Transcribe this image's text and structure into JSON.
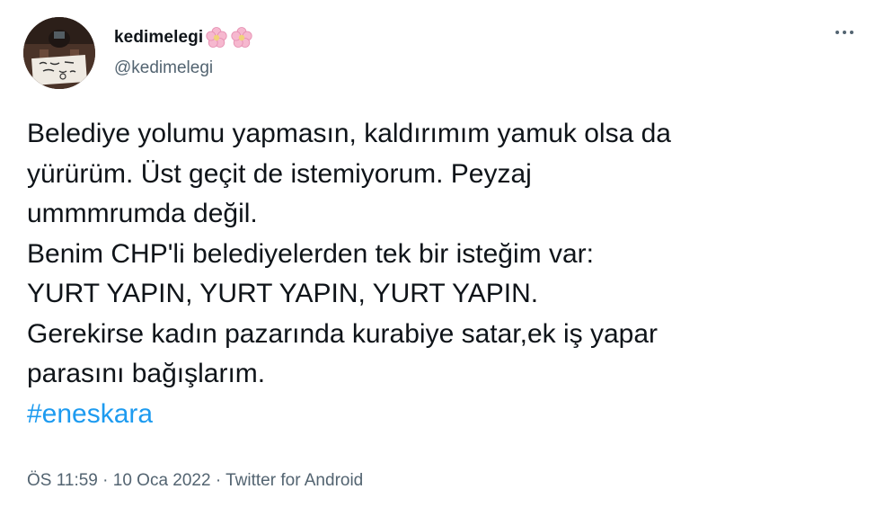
{
  "author": {
    "display_name": "kedimelegi",
    "handle": "@kedimelegi",
    "name_emojis": [
      "flower-emoji",
      "flower-emoji"
    ]
  },
  "tweet": {
    "lines": [
      "Belediye yolumu yapmasın, kaldırımım yamuk olsa da",
      "yürürüm. Üst geçit de istemiyorum. Peyzaj",
      "ummmrumda değil.",
      "Benim CHP'li belediyelerden tek bir isteğim var:",
      "YURT YAPIN, YURT YAPIN, YURT YAPIN.",
      "Gerekirse kadın pazarında kurabiye satar,ek iş yapar",
      "parasını bağışlarım."
    ],
    "hashtag": "#eneskara"
  },
  "meta": {
    "time": "ÖS 11:59",
    "separator": "·",
    "date": "10 Oca 2022",
    "source": "Twitter for Android"
  },
  "colors": {
    "text": "#0f1419",
    "secondary": "#536471",
    "link": "#1d9bf0"
  }
}
